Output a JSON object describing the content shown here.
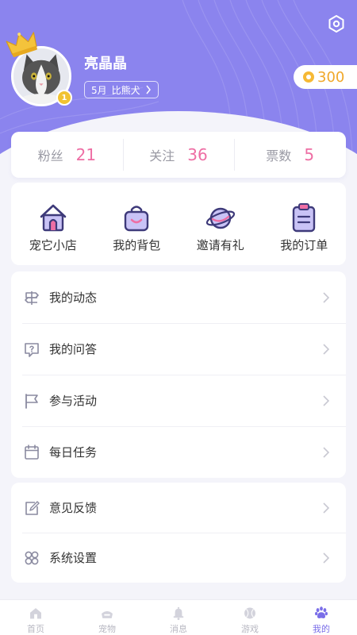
{
  "profile": {
    "name": "亮晶晶",
    "tag_month": "5月",
    "tag_breed": "比熊犬",
    "coins": "300",
    "level": "1"
  },
  "stats": [
    {
      "label": "粉丝",
      "value": "21"
    },
    {
      "label": "关注",
      "value": "36"
    },
    {
      "label": "票数",
      "value": "5"
    }
  ],
  "shortcuts": [
    {
      "label": "宠它小店",
      "icon": "shop-icon"
    },
    {
      "label": "我的背包",
      "icon": "bag-icon"
    },
    {
      "label": "邀请有礼",
      "icon": "planet-icon"
    },
    {
      "label": "我的订单",
      "icon": "clipboard-icon"
    }
  ],
  "menu1": [
    {
      "label": "我的动态",
      "icon": "signpost-icon"
    },
    {
      "label": "我的问答",
      "icon": "question-icon"
    },
    {
      "label": "参与活动",
      "icon": "flag-icon"
    },
    {
      "label": "每日任务",
      "icon": "calendar-icon"
    }
  ],
  "menu2": [
    {
      "label": "意见反馈",
      "icon": "feedback-icon"
    },
    {
      "label": "系统设置",
      "icon": "settings-grid-icon"
    }
  ],
  "tabbar": [
    {
      "label": "首页",
      "icon": "home-icon",
      "active": false
    },
    {
      "label": "宠物",
      "icon": "pet-bowl-icon",
      "active": false
    },
    {
      "label": "消息",
      "icon": "bell-icon",
      "active": false
    },
    {
      "label": "游戏",
      "icon": "ball-icon",
      "active": false
    },
    {
      "label": "我的",
      "icon": "paw-icon",
      "active": true
    }
  ],
  "colors": {
    "brand": "#8b84ee",
    "accent": "#ee6ea4",
    "coin": "#f0a82a",
    "active_tab": "#7a6ee8"
  }
}
